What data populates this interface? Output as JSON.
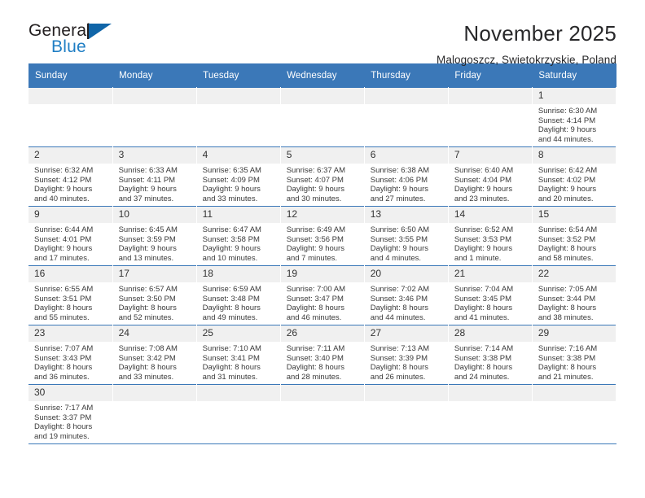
{
  "brand": {
    "name_top": "General",
    "name_bottom": "Blue",
    "accent_color": "#1065a8",
    "blue_text_color": "#1f7ec4"
  },
  "header": {
    "title": "November 2025",
    "location": "Malogoszcz, Swietokrzyskie, Poland"
  },
  "calendar": {
    "header_bg": "#3b78b8",
    "daynum_bg": "#f0f0f0",
    "weekday_headers": [
      "Sunday",
      "Monday",
      "Tuesday",
      "Wednesday",
      "Thursday",
      "Friday",
      "Saturday"
    ],
    "labels": {
      "sunrise": "Sunrise:",
      "sunset": "Sunset:",
      "daylight": "Daylight:"
    },
    "weeks": [
      [
        {
          "day": ""
        },
        {
          "day": ""
        },
        {
          "day": ""
        },
        {
          "day": ""
        },
        {
          "day": ""
        },
        {
          "day": ""
        },
        {
          "day": "1",
          "sunrise": "Sunrise: 6:30 AM",
          "sunset": "Sunset: 4:14 PM",
          "daylight1": "Daylight: 9 hours",
          "daylight2": "and 44 minutes."
        }
      ],
      [
        {
          "day": "2",
          "sunrise": "Sunrise: 6:32 AM",
          "sunset": "Sunset: 4:12 PM",
          "daylight1": "Daylight: 9 hours",
          "daylight2": "and 40 minutes."
        },
        {
          "day": "3",
          "sunrise": "Sunrise: 6:33 AM",
          "sunset": "Sunset: 4:11 PM",
          "daylight1": "Daylight: 9 hours",
          "daylight2": "and 37 minutes."
        },
        {
          "day": "4",
          "sunrise": "Sunrise: 6:35 AM",
          "sunset": "Sunset: 4:09 PM",
          "daylight1": "Daylight: 9 hours",
          "daylight2": "and 33 minutes."
        },
        {
          "day": "5",
          "sunrise": "Sunrise: 6:37 AM",
          "sunset": "Sunset: 4:07 PM",
          "daylight1": "Daylight: 9 hours",
          "daylight2": "and 30 minutes."
        },
        {
          "day": "6",
          "sunrise": "Sunrise: 6:38 AM",
          "sunset": "Sunset: 4:06 PM",
          "daylight1": "Daylight: 9 hours",
          "daylight2": "and 27 minutes."
        },
        {
          "day": "7",
          "sunrise": "Sunrise: 6:40 AM",
          "sunset": "Sunset: 4:04 PM",
          "daylight1": "Daylight: 9 hours",
          "daylight2": "and 23 minutes."
        },
        {
          "day": "8",
          "sunrise": "Sunrise: 6:42 AM",
          "sunset": "Sunset: 4:02 PM",
          "daylight1": "Daylight: 9 hours",
          "daylight2": "and 20 minutes."
        }
      ],
      [
        {
          "day": "9",
          "sunrise": "Sunrise: 6:44 AM",
          "sunset": "Sunset: 4:01 PM",
          "daylight1": "Daylight: 9 hours",
          "daylight2": "and 17 minutes."
        },
        {
          "day": "10",
          "sunrise": "Sunrise: 6:45 AM",
          "sunset": "Sunset: 3:59 PM",
          "daylight1": "Daylight: 9 hours",
          "daylight2": "and 13 minutes."
        },
        {
          "day": "11",
          "sunrise": "Sunrise: 6:47 AM",
          "sunset": "Sunset: 3:58 PM",
          "daylight1": "Daylight: 9 hours",
          "daylight2": "and 10 minutes."
        },
        {
          "day": "12",
          "sunrise": "Sunrise: 6:49 AM",
          "sunset": "Sunset: 3:56 PM",
          "daylight1": "Daylight: 9 hours",
          "daylight2": "and 7 minutes."
        },
        {
          "day": "13",
          "sunrise": "Sunrise: 6:50 AM",
          "sunset": "Sunset: 3:55 PM",
          "daylight1": "Daylight: 9 hours",
          "daylight2": "and 4 minutes."
        },
        {
          "day": "14",
          "sunrise": "Sunrise: 6:52 AM",
          "sunset": "Sunset: 3:53 PM",
          "daylight1": "Daylight: 9 hours",
          "daylight2": "and 1 minute."
        },
        {
          "day": "15",
          "sunrise": "Sunrise: 6:54 AM",
          "sunset": "Sunset: 3:52 PM",
          "daylight1": "Daylight: 8 hours",
          "daylight2": "and 58 minutes."
        }
      ],
      [
        {
          "day": "16",
          "sunrise": "Sunrise: 6:55 AM",
          "sunset": "Sunset: 3:51 PM",
          "daylight1": "Daylight: 8 hours",
          "daylight2": "and 55 minutes."
        },
        {
          "day": "17",
          "sunrise": "Sunrise: 6:57 AM",
          "sunset": "Sunset: 3:50 PM",
          "daylight1": "Daylight: 8 hours",
          "daylight2": "and 52 minutes."
        },
        {
          "day": "18",
          "sunrise": "Sunrise: 6:59 AM",
          "sunset": "Sunset: 3:48 PM",
          "daylight1": "Daylight: 8 hours",
          "daylight2": "and 49 minutes."
        },
        {
          "day": "19",
          "sunrise": "Sunrise: 7:00 AM",
          "sunset": "Sunset: 3:47 PM",
          "daylight1": "Daylight: 8 hours",
          "daylight2": "and 46 minutes."
        },
        {
          "day": "20",
          "sunrise": "Sunrise: 7:02 AM",
          "sunset": "Sunset: 3:46 PM",
          "daylight1": "Daylight: 8 hours",
          "daylight2": "and 44 minutes."
        },
        {
          "day": "21",
          "sunrise": "Sunrise: 7:04 AM",
          "sunset": "Sunset: 3:45 PM",
          "daylight1": "Daylight: 8 hours",
          "daylight2": "and 41 minutes."
        },
        {
          "day": "22",
          "sunrise": "Sunrise: 7:05 AM",
          "sunset": "Sunset: 3:44 PM",
          "daylight1": "Daylight: 8 hours",
          "daylight2": "and 38 minutes."
        }
      ],
      [
        {
          "day": "23",
          "sunrise": "Sunrise: 7:07 AM",
          "sunset": "Sunset: 3:43 PM",
          "daylight1": "Daylight: 8 hours",
          "daylight2": "and 36 minutes."
        },
        {
          "day": "24",
          "sunrise": "Sunrise: 7:08 AM",
          "sunset": "Sunset: 3:42 PM",
          "daylight1": "Daylight: 8 hours",
          "daylight2": "and 33 minutes."
        },
        {
          "day": "25",
          "sunrise": "Sunrise: 7:10 AM",
          "sunset": "Sunset: 3:41 PM",
          "daylight1": "Daylight: 8 hours",
          "daylight2": "and 31 minutes."
        },
        {
          "day": "26",
          "sunrise": "Sunrise: 7:11 AM",
          "sunset": "Sunset: 3:40 PM",
          "daylight1": "Daylight: 8 hours",
          "daylight2": "and 28 minutes."
        },
        {
          "day": "27",
          "sunrise": "Sunrise: 7:13 AM",
          "sunset": "Sunset: 3:39 PM",
          "daylight1": "Daylight: 8 hours",
          "daylight2": "and 26 minutes."
        },
        {
          "day": "28",
          "sunrise": "Sunrise: 7:14 AM",
          "sunset": "Sunset: 3:38 PM",
          "daylight1": "Daylight: 8 hours",
          "daylight2": "and 24 minutes."
        },
        {
          "day": "29",
          "sunrise": "Sunrise: 7:16 AM",
          "sunset": "Sunset: 3:38 PM",
          "daylight1": "Daylight: 8 hours",
          "daylight2": "and 21 minutes."
        }
      ],
      [
        {
          "day": "30",
          "sunrise": "Sunrise: 7:17 AM",
          "sunset": "Sunset: 3:37 PM",
          "daylight1": "Daylight: 8 hours",
          "daylight2": "and 19 minutes."
        },
        {
          "day": ""
        },
        {
          "day": ""
        },
        {
          "day": ""
        },
        {
          "day": ""
        },
        {
          "day": ""
        },
        {
          "day": ""
        }
      ]
    ]
  }
}
